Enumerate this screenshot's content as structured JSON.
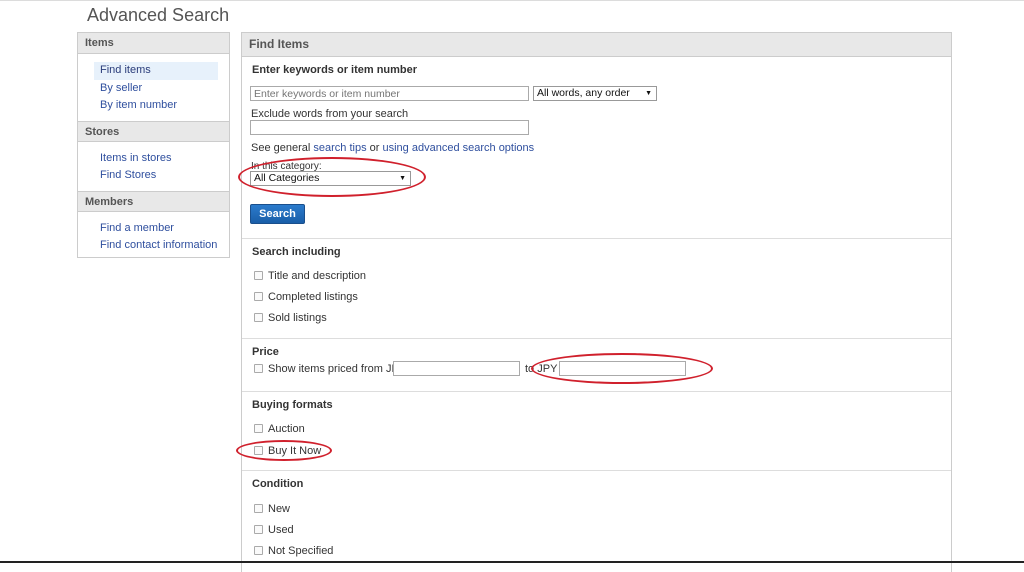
{
  "page": {
    "title": "Advanced Search"
  },
  "sidebar": {
    "sections": [
      {
        "title": "Items",
        "items": [
          {
            "label": "Find items",
            "active": true
          },
          {
            "label": "By seller",
            "active": false
          },
          {
            "label": "By item number",
            "active": false
          }
        ]
      },
      {
        "title": "Stores",
        "items": [
          {
            "label": "Items in stores",
            "active": false
          },
          {
            "label": "Find Stores",
            "active": false
          }
        ]
      },
      {
        "title": "Members",
        "items": [
          {
            "label": "Find a member",
            "active": false
          },
          {
            "label": "Find contact information",
            "active": false
          }
        ]
      }
    ]
  },
  "main": {
    "header": "Find Items",
    "keywords": {
      "label": "Enter keywords or item number",
      "placeholder": "Enter keywords or item number",
      "value": "",
      "order_select": "All words, any order"
    },
    "exclude": {
      "label": "Exclude words from your search",
      "value": ""
    },
    "tips": {
      "prefix": "See general ",
      "link1": "search tips",
      "middle": " or ",
      "link2": "using advanced search options"
    },
    "category": {
      "label": "In this category:",
      "selected": "All Categories"
    },
    "search_button": "Search",
    "search_including": {
      "title": "Search including",
      "options": [
        "Title and description",
        "Completed listings",
        "Sold listings"
      ]
    },
    "price": {
      "title": "Price",
      "from_label": "Show items priced from JPY",
      "to_label": "to JPY",
      "from_value": "",
      "to_value": ""
    },
    "buying_formats": {
      "title": "Buying formats",
      "options": [
        "Auction",
        "Buy It Now"
      ]
    },
    "condition": {
      "title": "Condition",
      "options": [
        "New",
        "Used",
        "Not Specified"
      ]
    }
  },
  "colors": {
    "link": "#2f4f9e",
    "button": "#1a5ea8",
    "annotation": "#d0202c",
    "header_bg": "#e8e8e8"
  }
}
